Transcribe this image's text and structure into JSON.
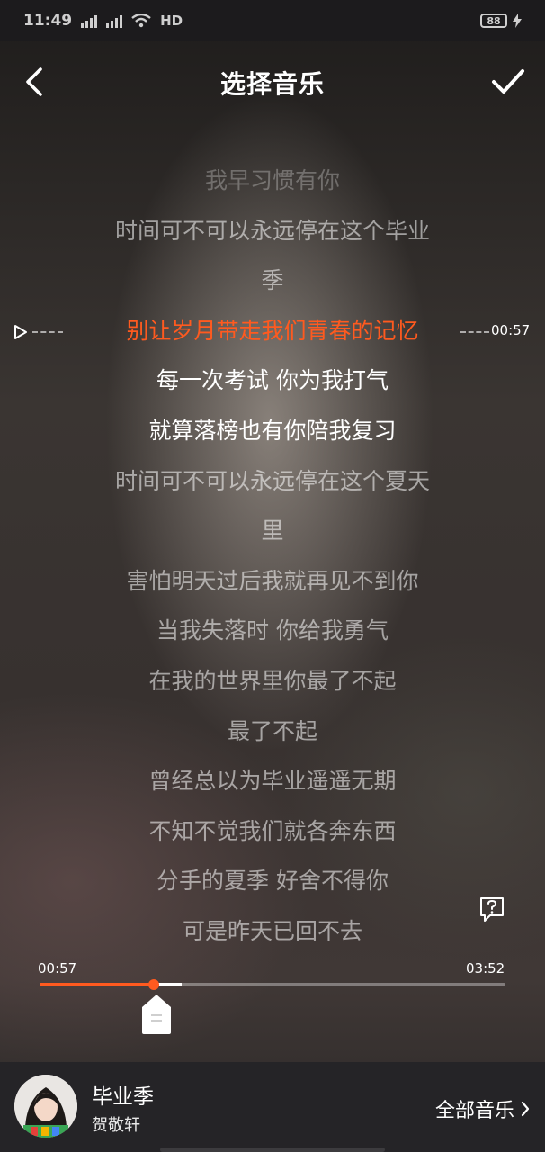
{
  "status_bar": {
    "time": "11:49",
    "net1": "4G",
    "net2": "2G",
    "hd": "HD",
    "battery": "88",
    "charging_icon": "lightning-icon"
  },
  "header": {
    "title": "选择音乐",
    "back_icon": "chevron-left-icon",
    "confirm_icon": "check-icon"
  },
  "lyrics": [
    {
      "text": "我早习惯有你",
      "state": "faint"
    },
    {
      "text": "时间可不可以永远停在这个毕业",
      "state": "dim"
    },
    {
      "text": "季",
      "state": "dim"
    },
    {
      "text": "别让岁月带走我们青春的记忆",
      "state": "active"
    },
    {
      "text": "每一次考试 你为我打气",
      "state": "bright"
    },
    {
      "text": "就算落榜也有你陪我复习",
      "state": "bright"
    },
    {
      "text": "时间可不可以永远停在这个夏天",
      "state": "dim"
    },
    {
      "text": "里",
      "state": "dim"
    },
    {
      "text": "害怕明天过后我就再见不到你",
      "state": "dim"
    },
    {
      "text": "当我失落时 你给我勇气",
      "state": "dim"
    },
    {
      "text": "在我的世界里你最了不起",
      "state": "dim"
    },
    {
      "text": "最了不起",
      "state": "dim"
    },
    {
      "text": "曾经总以为毕业遥遥无期",
      "state": "dim"
    },
    {
      "text": "不知不觉我们就各奔东西",
      "state": "dim"
    },
    {
      "text": "分手的夏季 好舍不得你",
      "state": "dim"
    },
    {
      "text": "可是昨天已回不去",
      "state": "dim"
    }
  ],
  "position_marker": {
    "time": "00:57"
  },
  "player": {
    "current_time": "00:57",
    "total_time": "03:52",
    "progress_fraction": 0.2457,
    "selection_end_fraction": 0.3059
  },
  "footer": {
    "song_title": "毕业季",
    "artist": "贺敬轩",
    "all_music_label": "全部音乐"
  },
  "colors": {
    "accent": "#ff5a1f",
    "footer_bg": "#252427",
    "status_bg": "#1c1b1d"
  }
}
